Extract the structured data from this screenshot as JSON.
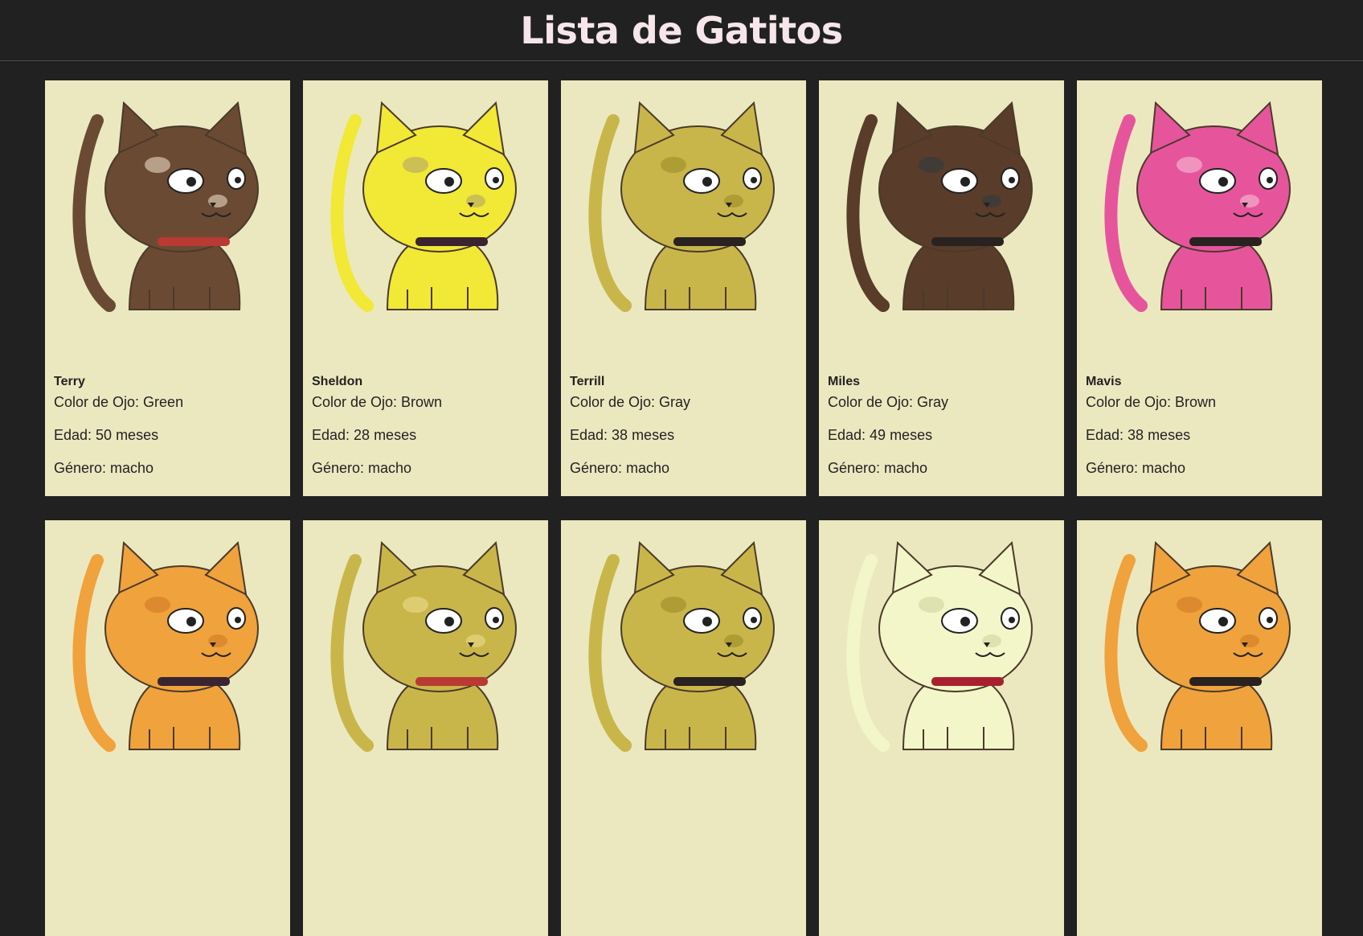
{
  "header": {
    "title": "Lista de Gatitos"
  },
  "labels": {
    "eye": "Color de Ojo: ",
    "age": "Edad: ",
    "age_unit": " meses",
    "gender": "Género: "
  },
  "cats": [
    {
      "name": "Terry",
      "eye": "Green",
      "age": "50",
      "gender": "macho",
      "fur": "#6b4a34",
      "accent": "#c9b5a0",
      "collar": "#b83a32"
    },
    {
      "name": "Sheldon",
      "eye": "Brown",
      "age": "28",
      "gender": "macho",
      "fur": "#f2e836",
      "accent": "#c2b45c",
      "collar": "#3a2430"
    },
    {
      "name": "Terrill",
      "eye": "Gray",
      "age": "38",
      "gender": "macho",
      "fur": "#c9b64a",
      "accent": "#a8962e",
      "collar": "#2a2220"
    },
    {
      "name": "Miles",
      "eye": "Gray",
      "age": "49",
      "gender": "macho",
      "fur": "#5a3c2a",
      "accent": "#3b3b3b",
      "collar": "#2a2220"
    },
    {
      "name": "Mavis",
      "eye": "Brown",
      "age": "38",
      "gender": "macho",
      "fur": "#e6559c",
      "accent": "#f2a3c8",
      "collar": "#2a2220"
    },
    {
      "name": "",
      "eye": "",
      "age": "",
      "gender": "",
      "fur": "#f0a23c",
      "accent": "#d8852a",
      "collar": "#3a2430"
    },
    {
      "name": "",
      "eye": "",
      "age": "",
      "gender": "",
      "fur": "#c9b64a",
      "accent": "#e3d27a",
      "collar": "#b83a32"
    },
    {
      "name": "",
      "eye": "",
      "age": "",
      "gender": "",
      "fur": "#c9b64a",
      "accent": "#a8962e",
      "collar": "#2a2220"
    },
    {
      "name": "",
      "eye": "",
      "age": "",
      "gender": "",
      "fur": "#f3f6c8",
      "accent": "#d8dcaa",
      "collar": "#a8202e"
    },
    {
      "name": "",
      "eye": "",
      "age": "",
      "gender": "",
      "fur": "#f0a23c",
      "accent": "#d8852a",
      "collar": "#2a2220"
    }
  ]
}
